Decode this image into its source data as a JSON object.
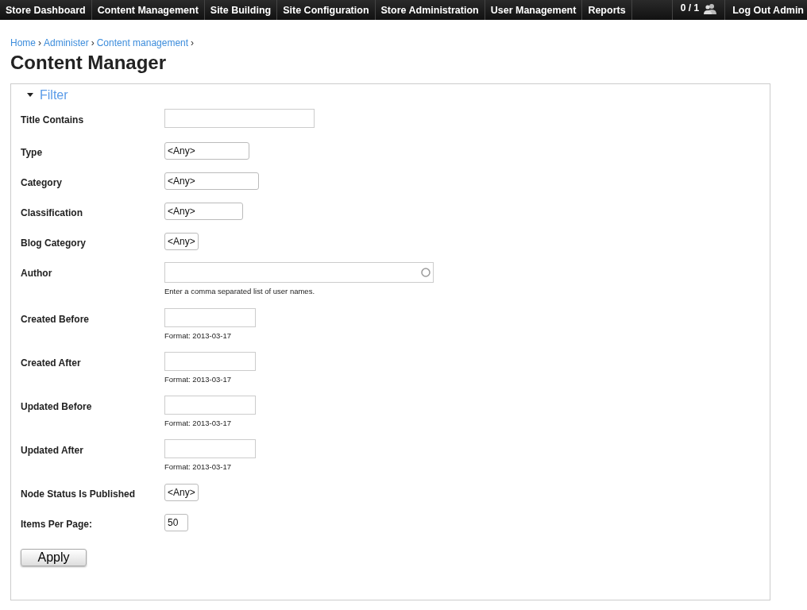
{
  "nav": {
    "items": [
      {
        "label": "Store Dashboard"
      },
      {
        "label": "Content Management"
      },
      {
        "label": "Site Building"
      },
      {
        "label": "Site Configuration"
      },
      {
        "label": "Store Administration"
      },
      {
        "label": "User Management"
      },
      {
        "label": "Reports"
      }
    ],
    "users_count": "0 / 1",
    "logout": "Log Out Admin"
  },
  "breadcrumb": [
    {
      "label": "Home",
      "separator": "›"
    },
    {
      "label": "Administer",
      "separator": "›"
    },
    {
      "label": "Content management",
      "separator": "›"
    }
  ],
  "title": "Content Manager",
  "filter": {
    "legend": "Filter",
    "expanded": true,
    "fields": [
      {
        "kind": "text",
        "label": "Title Contains"
      },
      {
        "kind": "select",
        "label": "Type",
        "value": "<Any>"
      },
      {
        "kind": "select",
        "label": "Category",
        "value": "<Any>"
      },
      {
        "kind": "select",
        "label": "Classification",
        "value": "<Any>"
      },
      {
        "kind": "select",
        "label": "Blog Category",
        "value": "<Any>"
      },
      {
        "kind": "autocomplete",
        "label": "Author",
        "description": "Enter a comma separated list of user names."
      },
      {
        "kind": "date",
        "label": "Created Before",
        "description": "Format: 2013-03-17"
      },
      {
        "kind": "date",
        "label": "Created After",
        "description": "Format: 2013-03-17"
      },
      {
        "kind": "date",
        "label": "Updated Before",
        "description": "Format: 2013-03-17"
      },
      {
        "kind": "date",
        "label": "Updated After",
        "description": "Format: 2013-03-17"
      },
      {
        "kind": "select",
        "label": "Node Status Is Published",
        "value": "<Any>"
      },
      {
        "kind": "select",
        "label": "Items Per Page:",
        "value": "50"
      }
    ],
    "apply": "Apply"
  }
}
